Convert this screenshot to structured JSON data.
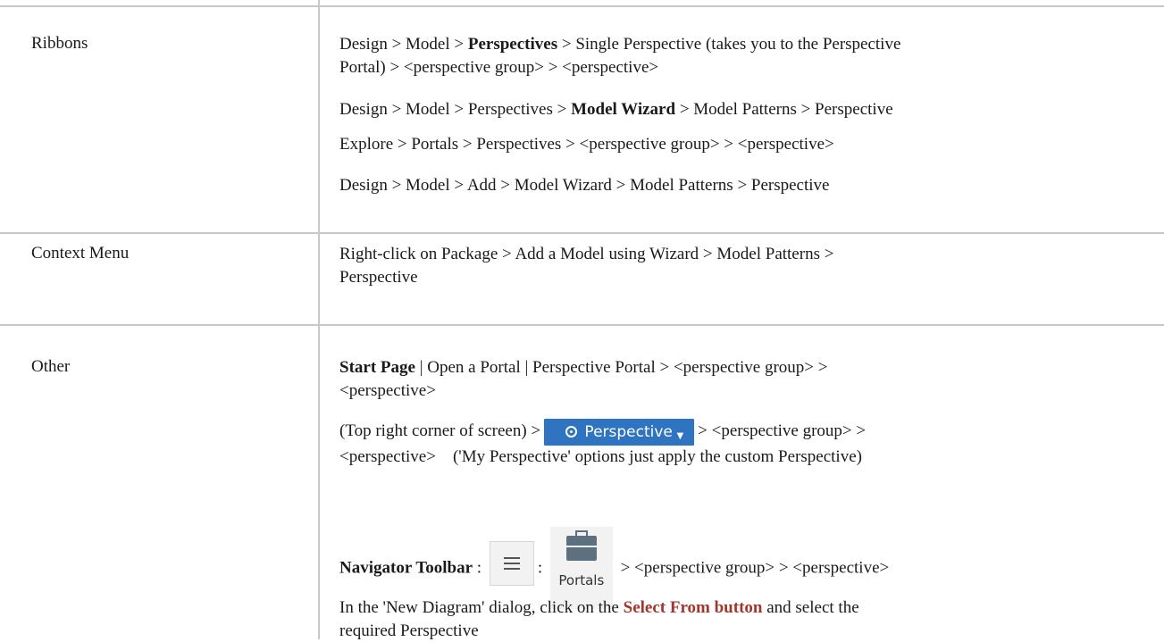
{
  "rows": [
    {
      "label": "Ribbons",
      "lines": [
        {
          "pre": "Design > Model > ",
          "bold": "Perspectives",
          "post": " > Single Perspective (takes you to the Perspective"
        },
        {
          "pre": "Portal) > <perspective group> > <perspective>"
        },
        {
          "pre": "Design > Model > Perspectives > ",
          "bold": "Model Wizard",
          "post": " > Model Patterns > Perspective"
        },
        {
          "pre": "Explore > Portals > Perspectives > <perspective group> > <perspective>"
        },
        {
          "pre": "Design > Model > Add > Model Wizard > Model Patterns > Perspective"
        }
      ]
    },
    {
      "label": "Context Menu",
      "lines": [
        {
          "pre": "Right-click on Package > Add a Model using Wizard > Model Patterns >"
        },
        {
          "pre": "Perspective"
        }
      ]
    },
    {
      "label": "Other",
      "start_page": {
        "bold": "Start Page",
        "post": " | Open a Portal | Perspective Portal > <perspective group> >",
        "line2": "<perspective>"
      },
      "top_right": {
        "pre": "(Top right corner of screen) >",
        "button_label": "Perspective",
        "post": "> <perspective group> >",
        "line2": "<perspective>    ('My Perspective' options just apply the custom Perspective)"
      },
      "navigator": {
        "bold": "Navigator Toolbar",
        "sep1": " :",
        "sep2": ":",
        "portals_label": "Portals",
        "post": "> <perspective group> > <perspective>"
      },
      "new_diagram": {
        "pre": "In the 'New Diagram' dialog, click on the ",
        "link": "Select From button",
        "post": " and select the",
        "line2": "required Perspective"
      }
    }
  ],
  "colors": {
    "link": "#a0362c",
    "button": "#2f74c0",
    "border": "#c8c8c8"
  },
  "icons": {
    "perspective_button": "eye-icon",
    "menu_button": "hamburger-menu-icon",
    "portals_button": "briefcase-icon"
  }
}
